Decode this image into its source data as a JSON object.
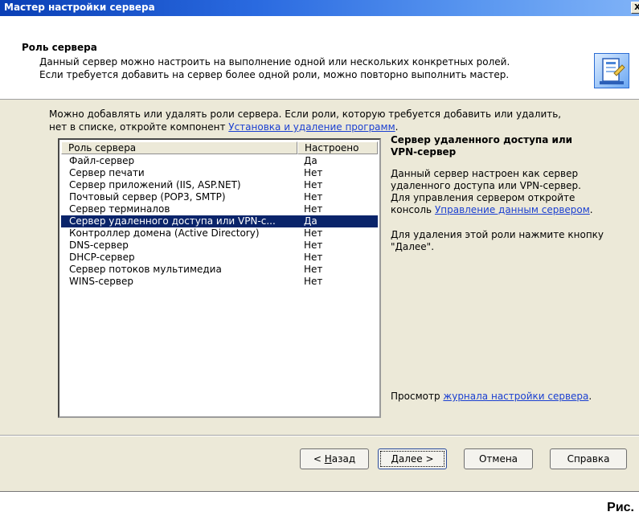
{
  "window": {
    "title": "Мастер настройки сервера",
    "close_label": "X"
  },
  "header": {
    "title": "Роль сервера",
    "desc_line1": "Данный сервер можно настроить на выполнение одной или нескольких конкретных ролей.",
    "desc_line2": "Если требуется добавить на сервер более одной роли, можно повторно выполнить мастер.",
    "icon": "wizard-server-icon"
  },
  "intro": {
    "line1": "Можно добавлять или удалять роли сервера. Если роли, которую требуется добавить или удалить,",
    "line2_prefix": "нет в списке, откройте компонент ",
    "line2_link": "Установка и удаление программ",
    "line2_suffix": "."
  },
  "list": {
    "columns": [
      "Роль сервера",
      "Настроено"
    ],
    "rows": [
      {
        "role": "Файл-сервер",
        "configured": "Да"
      },
      {
        "role": "Сервер печати",
        "configured": "Нет"
      },
      {
        "role": "Сервер приложений (IIS, ASP.NET)",
        "configured": "Нет"
      },
      {
        "role": "Почтовый сервер (POP3, SMTP)",
        "configured": "Нет"
      },
      {
        "role": "Сервер терминалов",
        "configured": "Нет"
      },
      {
        "role": "Сервер удаленного доступа или VPN-с...",
        "configured": "Да"
      },
      {
        "role": "Контроллер домена (Active Directory)",
        "configured": "Нет"
      },
      {
        "role": "DNS-сервер",
        "configured": "Нет"
      },
      {
        "role": "DHCP-сервер",
        "configured": "Нет"
      },
      {
        "role": "Сервер потоков мультимедиа",
        "configured": "Нет"
      },
      {
        "role": "WINS-сервер",
        "configured": "Нет"
      }
    ],
    "selected_index": 5
  },
  "description": {
    "title_line1": "Сервер удаленного доступа или",
    "title_line2": "VPN-сервер",
    "p1_line1": "Данный сервер настроен как сервер",
    "p1_line2": "удаленного доступа или VPN-сервер.",
    "p1_line3": "Для управления сервером откройте",
    "p1_line4_prefix": "консоль ",
    "p1_line4_link": "Управление данным сервером",
    "p1_line4_suffix": ".",
    "p2_line1": "Для удаления этой роли нажмите кнопку",
    "p2_line2": "\"Далее\".",
    "log_prefix": "Просмотр ",
    "log_link": "журнала настройки сервера",
    "log_suffix": "."
  },
  "buttons": {
    "back_lt": "< ",
    "back_letter": "Н",
    "back_rest": "азад",
    "next_letter": "Д",
    "next_rest": "алее >",
    "cancel": "Отмена",
    "help": "Справка"
  },
  "caption": "Рис."
}
